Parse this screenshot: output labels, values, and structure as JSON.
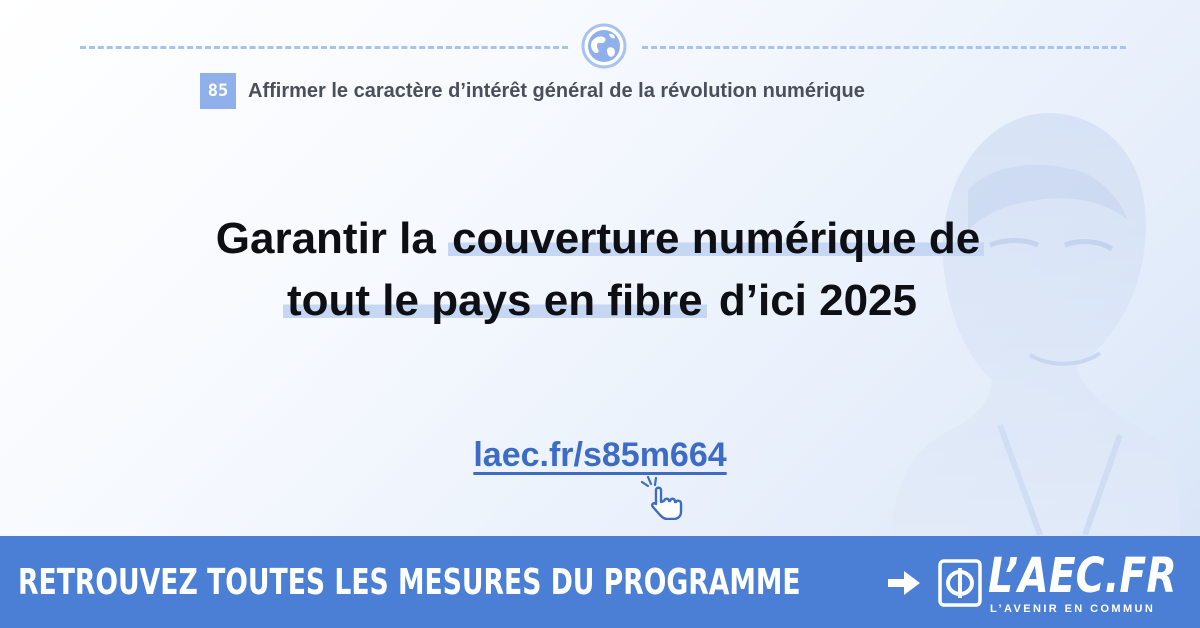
{
  "category": {
    "number": "85",
    "text": "Affirmer le caractère d’intérêt général de la révolution numérique",
    "icon": "globe-icon"
  },
  "headline": {
    "part1": "Garantir la ",
    "highlight1": "couverture numérique de",
    "highlight2": "tout le pays en fibre",
    "part2": " d’ici 2025"
  },
  "link": {
    "text": "laec.fr/s85m664",
    "icon": "pointing-hand-icon"
  },
  "banner": {
    "text": "RETROUVEZ TOUTES LES MESURES DU PROGRAMME",
    "arrow_icon": "arrow-right-icon",
    "logo_text": "L’AEC.FR",
    "logo_subtitle": "L’AVENIR EN COMMUN",
    "logo_icon": "phi-book-icon"
  },
  "colors": {
    "accent": "#4b7fd6",
    "highlight": "#c5d7f3",
    "badge": "#8fb0ea",
    "link": "#3d6cc7",
    "text": "#0d0f14"
  }
}
